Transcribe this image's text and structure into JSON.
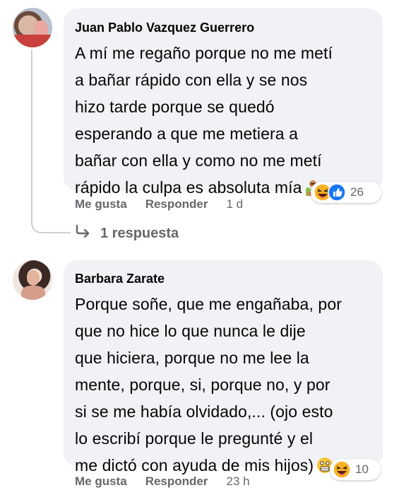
{
  "comments": [
    {
      "author": "Juan Pablo Vazquez Guerrero",
      "lines": [
        "A mí me regaño porque no me metí",
        "a bañar rápido con ella y se nos",
        "hizo tarde porque se quedó",
        "esperando a que me metiera a",
        "bañar con ella y como no me metí",
        "rápido la culpa es absoluta mía"
      ],
      "trailing_emoji": "person-shrugging-icon",
      "reactions": {
        "icons": [
          "haha-icon",
          "like-icon"
        ],
        "count": "26"
      },
      "actions": {
        "like": "Me gusta",
        "reply": "Responder",
        "time": "1 d"
      },
      "replies_label": "1 respuesta"
    },
    {
      "author": "Barbara Zarate",
      "lines": [
        "Porque soñe, que me engañaba, por",
        "que no hice lo que nunca le dije",
        "que hiciera, porque no me lee la",
        "mente, porque, si, porque no, y por",
        "si se me había olvidado,... (ojo esto",
        "lo escribí porque le pregunté y el",
        "me dictó con ayuda de mis hijos)"
      ],
      "trailing_emoji": "scared-face-icon",
      "reactions": {
        "icons": [
          "haha-icon"
        ],
        "count": "10"
      },
      "actions": {
        "like": "Me gusta",
        "reply": "Responder",
        "time": "23 h"
      }
    }
  ],
  "colors": {
    "bubble": "#f0f2f5",
    "meta_text": "#65676b",
    "like_blue": "#1877f2",
    "haha_yellow": "#f7b125"
  }
}
